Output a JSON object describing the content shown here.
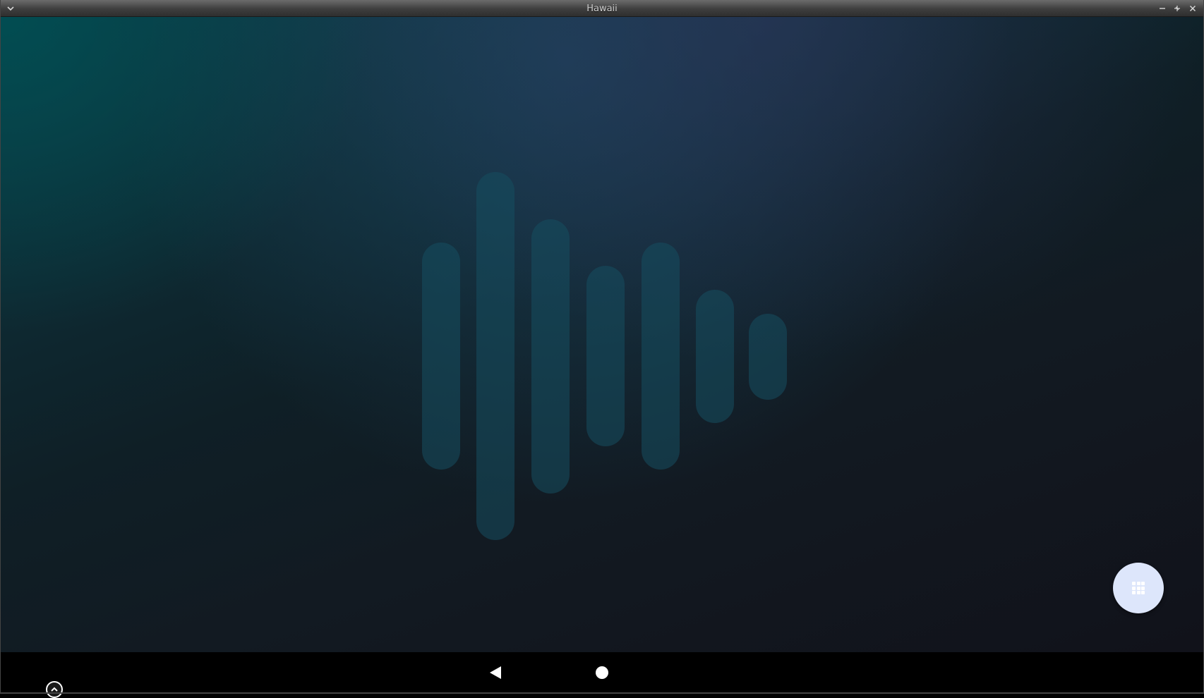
{
  "window": {
    "title": "Hawaii",
    "buttons": {
      "menu_icon": "chevron-down-icon",
      "minimize_icon": "minimize-icon",
      "maximize_icon": "maximize-icon",
      "close_icon": "close-icon"
    }
  },
  "desktop": {
    "logo_icon": "audio-waveform-logo",
    "logo_bar_count": 7,
    "fab_icon": "app-grid-icon",
    "colors": {
      "fab_background": "#dde6fb",
      "logo_bars": "#164e60",
      "background_top_left": "#004850",
      "background_bottom_right": "#11121a"
    }
  },
  "navbar": {
    "back_icon": "back-triangle-icon",
    "home_icon": "home-circle-icon",
    "handle_icon": "expand-up-icon"
  }
}
